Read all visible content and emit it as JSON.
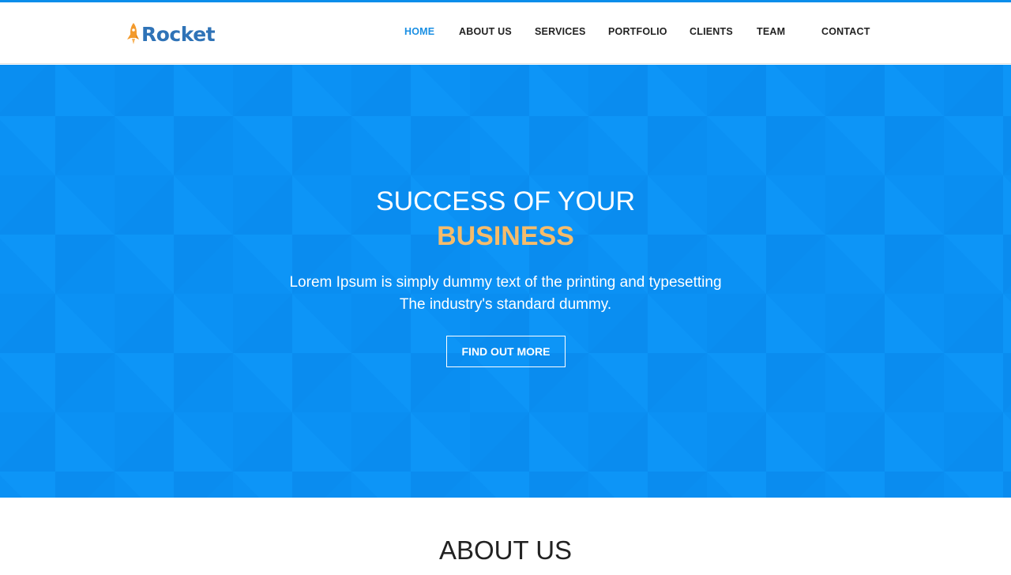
{
  "brand": {
    "name": "Rocket",
    "colors": {
      "text": "#2f73b7",
      "icon": "#f39a2c"
    }
  },
  "nav": {
    "items": [
      {
        "label": "HOME",
        "active": true
      },
      {
        "label": "ABOUT US",
        "active": false
      },
      {
        "label": "SERVICES",
        "active": false
      },
      {
        "label": "PORTFOLIO",
        "active": false
      },
      {
        "label": "CLIENTS",
        "active": false
      },
      {
        "label": "TEAM",
        "active": false
      },
      {
        "label": "CONTACT",
        "active": false
      }
    ],
    "active_color": "#1a8fe3"
  },
  "hero": {
    "title": "SUCCESS OF YOUR",
    "title_accent": "BUSINESS",
    "text_line1": "Lorem Ipsum is simply dummy text of the printing and typesetting",
    "text_line2": "The industry's standard dummy.",
    "button_label": "FIND OUT MORE",
    "background_color": "#0b91f4",
    "accent_color": "#f5bc6b"
  },
  "about": {
    "title": "ABOUT US"
  }
}
